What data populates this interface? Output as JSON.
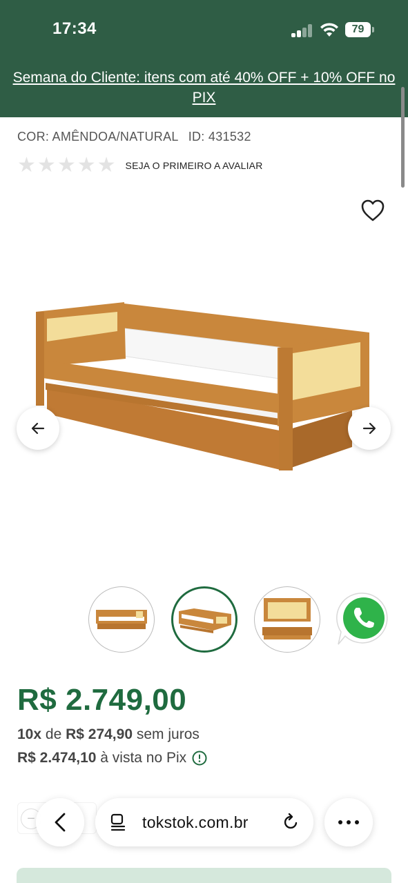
{
  "status_bar": {
    "time": "17:34",
    "battery": "79"
  },
  "promo_banner": {
    "text": "Semana do Cliente: itens com até 40% OFF + 10% OFF no PIX"
  },
  "product": {
    "color_label": "COR: AMÊNDOA/NATURAL",
    "id_label": "ID: 431532",
    "rating": {
      "stars": [
        "★",
        "★",
        "★",
        "★",
        "★"
      ],
      "filled": 0,
      "cta": "SEJA O PRIMEIRO A AVALIAR"
    },
    "price": "R$ 2.749,00",
    "installments": {
      "count": "10x",
      "connector": "de",
      "amount": "R$ 274,90",
      "suffix": "sem juros"
    },
    "pix": {
      "amount": "R$ 2.474,10",
      "suffix": "à vista no Pix"
    },
    "quantity": {
      "minus": "−"
    }
  },
  "gallery": {
    "thumbnails": 3,
    "active_index": 1
  },
  "browser": {
    "url": "tokstok.com.br"
  },
  "colors": {
    "header": "#2f5d45",
    "price": "#1f6b3f",
    "wood": "#c9873c",
    "cushion": "#f3dd9a"
  }
}
